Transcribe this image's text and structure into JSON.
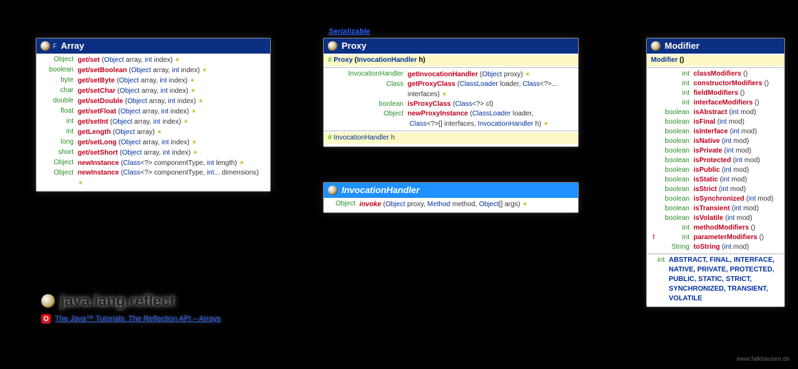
{
  "package": {
    "name": "java.lang.reflect",
    "link_label": "The Java™ Tutorials: The Reflection API – Arrays"
  },
  "watermark": "www.falkhausen.de",
  "serializable_label": "Serializable",
  "array": {
    "title": "Array",
    "retw": 48,
    "rows": [
      {
        "ret": "Object",
        "name": "get/set",
        "sig": "(<t>Object</t> array, <t>int</t> index)",
        "sun": true
      },
      {
        "ret": "boolean",
        "name": "get/setBoolean",
        "sig": "(<t>Object</t> array, <t>int</t> index)",
        "sun": true
      },
      {
        "ret": "byte",
        "name": "get/setByte",
        "sig": "(<t>Object</t> array, <t>int</t> index)",
        "sun": true
      },
      {
        "ret": "char",
        "name": "get/setChar",
        "sig": "(<t>Object</t> array, <t>int</t> index)",
        "sun": true
      },
      {
        "ret": "double",
        "name": "get/setDouble",
        "sig": "(<t>Object</t> array, <t>int</t> index)",
        "sun": true
      },
      {
        "ret": "float",
        "name": "get/setFloat",
        "sig": "(<t>Object</t> array, <t>int</t> index)",
        "sun": true
      },
      {
        "ret": "int",
        "name": "get/setInt",
        "sig": "(<t>Object</t> array, <t>int</t> index)",
        "sun": true
      },
      {
        "ret": "int",
        "name": "getLength",
        "sig": "(<t>Object</t> array)",
        "sun": true
      },
      {
        "ret": "long",
        "name": "get/setLong",
        "sig": "(<t>Object</t> array, <t>int</t> index)",
        "sun": true
      },
      {
        "ret": "short",
        "name": "get/setShort",
        "sig": "(<t>Object</t> array, <t>int</t> index)",
        "sun": true
      },
      {
        "ret": "Object",
        "name": "newInstance",
        "sig": "(<t>Class</t>&lt;?&gt; componentType, <t>int</t> length)",
        "sun": true
      },
      {
        "ret": "Object",
        "name": "newInstance",
        "sig": "(<t>Class</t>&lt;?&gt; componentType, <t>int</t>... dimensions)",
        "sun": true
      }
    ]
  },
  "proxy": {
    "title": "Proxy",
    "ctor": "<b class='hash'>#</b> <span class='typ' style='font-weight:bold'>Proxy</span> (<span class='typ'>InvocationHandler</span> h)",
    "retw": 110,
    "rows": [
      {
        "ret": "InvocationHandler",
        "name": "getInvocationHandler",
        "sig": "(<t>Object</t> proxy)",
        "sun": true
      },
      {
        "ret": "Class<?>",
        "name": "getProxyClass",
        "sig": "(<t>ClassLoader</t> loader, <t>Class</t>&lt;?&gt;... interfaces)",
        "sun": true
      },
      {
        "ret": "boolean",
        "name": "isProxyClass",
        "sig": "(<t>Class</t>&lt;?&gt; cl)"
      },
      {
        "ret": "Object",
        "name": "newProxyInstance",
        "sig": "(<t>ClassLoader</t> loader,<br>&nbsp;<t>Class</t>&lt;?&gt;[] interfaces, <t>InvocationHandler</t> h)",
        "sun": true
      }
    ],
    "field": "<b class='hash'>#</b> <span class='typ'>InvocationHandler</span> <span class='pn'>h</span>"
  },
  "invh": {
    "title": "InvocationHandler",
    "retw": 40,
    "rows": [
      {
        "ret": "Object",
        "name": "invoke",
        "italic": true,
        "sig": "(<t>Object</t> proxy, <t>Method</t> method, <t>Object</t>[] args)",
        "sun": true
      }
    ]
  },
  "modifier": {
    "title": "Modifier",
    "ctor": "<span class='typ' style='font-weight:bold'>Modifier</span> ()",
    "retw": 48,
    "rows": [
      {
        "ret": "int",
        "name": "classModifiers",
        "sig": "()"
      },
      {
        "ret": "int",
        "name": "constructorModifiers",
        "sig": "()"
      },
      {
        "ret": "int",
        "name": "fieldModifiers",
        "sig": "()"
      },
      {
        "ret": "int",
        "name": "interfaceModifiers",
        "sig": "()"
      },
      {
        "ret": "boolean",
        "name": "isAbstract",
        "sig": "(<t>int</t> mod)"
      },
      {
        "ret": "boolean",
        "name": "isFinal",
        "sig": "(<t>int</t> mod)"
      },
      {
        "ret": "boolean",
        "name": "isInterface",
        "sig": "(<t>int</t> mod)"
      },
      {
        "ret": "boolean",
        "name": "isNative",
        "sig": "(<t>int</t> mod)"
      },
      {
        "ret": "boolean",
        "name": "isPrivate",
        "sig": "(<t>int</t> mod)"
      },
      {
        "ret": "boolean",
        "name": "isProtected",
        "sig": "(<t>int</t> mod)"
      },
      {
        "ret": "boolean",
        "name": "isPublic",
        "sig": "(<t>int</t> mod)"
      },
      {
        "ret": "boolean",
        "name": "isStatic",
        "sig": "(<t>int</t> mod)"
      },
      {
        "ret": "boolean",
        "name": "isStrict",
        "sig": "(<t>int</t> mod)"
      },
      {
        "ret": "boolean",
        "name": "isSynchronized",
        "sig": "(<t>int</t> mod)"
      },
      {
        "ret": "boolean",
        "name": "isTransient",
        "sig": "(<t>int</t> mod)"
      },
      {
        "ret": "boolean",
        "name": "isVolatile",
        "sig": "(<t>int</t> mod)"
      },
      {
        "ret": "int",
        "name": "methodModifiers",
        "sig": "()"
      },
      {
        "mark": "!",
        "ret": "int",
        "name": "parameterModifiers",
        "sig": "()"
      },
      {
        "ret": "String",
        "name": "toString",
        "sig": "(<t>int</t> mod)"
      }
    ],
    "consts_ret": "int",
    "consts": "ABSTRACT, FINAL, INTERFACE, NATIVE, PRIVATE, PROTECTED, PUBLIC, STATIC, STRICT, SYNCHRONIZED, TRANSIENT, VOLATILE"
  }
}
